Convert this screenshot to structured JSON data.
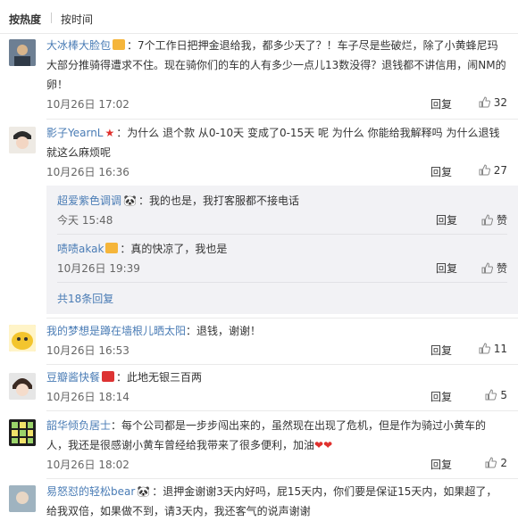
{
  "tabs": {
    "hot": "按热度",
    "time": "按时间"
  },
  "comments": [
    {
      "user": "大冰棒大脸包",
      "text": "：7个工作日把押金退给我，都多少天了？！车子尽是些破烂，除了小黄蜂尼玛大部分推骑得遭求不住。现在骑你们的车的人有多少一点儿13数没得？退钱都不讲信用，闹NM的卵！",
      "time": "10月26日 17:02",
      "reply": "回复",
      "likes": "32"
    },
    {
      "user": "影子YearnL",
      "text": "：为什么 退个款 从0-10天 变成了0-15天 呢  为什么  你能给我解释吗  为什么退钱就这么麻烦呢",
      "time": "10月26日 16:36",
      "reply": "回复",
      "likes": "27"
    },
    {
      "user": "我的梦想是蹲在墙根儿晒太阳",
      "text": "：退钱，谢谢！",
      "time": "10月26日 16:53",
      "reply": "回复",
      "likes": "11"
    },
    {
      "user": "豆瓣酱快餐",
      "text": "：此地无银三百两",
      "time": "10月26日 18:14",
      "reply": "回复",
      "likes": "5"
    },
    {
      "user": "韶华倾负居士",
      "text": "：每个公司都是一步步闯出来的，虽然现在出现了危机，但是作为骑过小黄车的人，我还是很感谢小黄车曾经给我带来了很多便利，加油",
      "time": "10月26日 18:02",
      "reply": "回复",
      "likes": "2"
    },
    {
      "user": "易怒怼的轻松bear",
      "text": "：退押金谢谢3天内好吗，屁15天内，你们要是保证15天内，如果超了，给我双倍，如果做不到，请3天内，我还客气的说声谢谢"
    }
  ],
  "replies": [
    {
      "user": "超爱紫色调调",
      "text": "：我的也是，我打客服都不接电话",
      "time": "今天 15:48",
      "reply": "回复",
      "like": "赞"
    },
    {
      "user": "啧啧akak",
      "text": "：真的快凉了，我也是",
      "time": "10月26日 19:39",
      "reply": "回复",
      "like": "赞"
    }
  ],
  "more_replies": "共18条回复",
  "colors": {
    "username": "#eb7350",
    "link": "#4a7cb5",
    "heart": "#e0302d"
  }
}
